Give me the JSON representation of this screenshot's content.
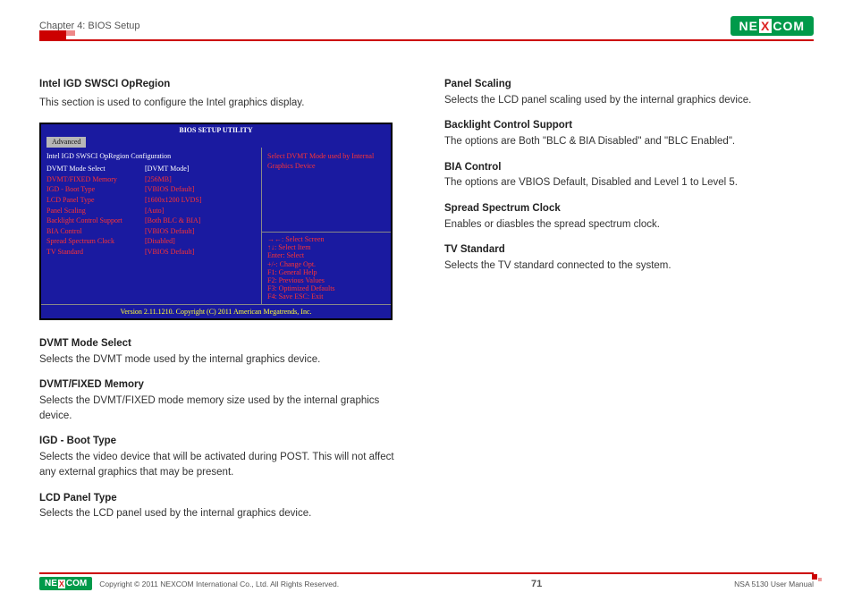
{
  "header": {
    "chapter": "Chapter 4: BIOS Setup",
    "brand": "NE",
    "brandX": "X",
    "brand2": "COM"
  },
  "left": {
    "title": "Intel IGD SWSCI OpRegion",
    "intro": "This section is used to configure the Intel graphics display.",
    "bios": {
      "title": "BIOS SETUP UTILITY",
      "tab": "Advanced",
      "section": "Intel IGD SWSCI OpRegion Configuration",
      "items": [
        {
          "label": "DVMT Mode Select",
          "value": "[DVMT Mode]"
        },
        {
          "label": "DVMT/FIXED Memory",
          "value": "[256MB]"
        },
        {
          "label": "IGD - Boot Type",
          "value": "[VBIOS Default]"
        },
        {
          "label": "LCD Panel Type",
          "value": "[1600x1200 LVDS]"
        },
        {
          "label": "Panel Scaling",
          "value": "[Auto]"
        },
        {
          "label": "Backlight Control Support",
          "value": "[Both BLC & BIA]"
        },
        {
          "label": "BIA Control",
          "value": "[VBIOS Default]"
        },
        {
          "label": "Spread Spectrum Clock",
          "value": "[Disabled]"
        },
        {
          "label": "TV Standard",
          "value": "[VBIOS Default]"
        }
      ],
      "help": "Select DVMT Mode used by Internal Graphics Device",
      "keys": [
        "→←:   Select Screen",
        "↑↓:    Select Item",
        "Enter: Select",
        "+/-:   Change Opt.",
        "F1:    General Help",
        "F2:    Previous Values",
        "F3:    Optimized Defaults",
        "F4:    Save   ESC: Exit"
      ],
      "version": "Version 2.11.1210. Copyright (C) 2011 American Megatrends, Inc."
    },
    "sections": [
      {
        "h": "DVMT Mode Select",
        "p": "Selects the DVMT mode used by the internal graphics device."
      },
      {
        "h": "DVMT/FIXED Memory",
        "p": "Selects the DVMT/FIXED mode memory size used by the internal graphics device."
      },
      {
        "h": "IGD - Boot Type",
        "p": "Selects the video device that will be activated during POST. This will not affect any external graphics that may be present."
      },
      {
        "h": "LCD Panel Type",
        "p": "Selects the LCD panel used by the internal graphics device."
      }
    ]
  },
  "right": {
    "sections": [
      {
        "h": "Panel Scaling",
        "p": "Selects the LCD panel scaling used by the internal graphics device."
      },
      {
        "h": "Backlight Control Support",
        "p": "The options are Both \"BLC & BIA Disabled\" and \"BLC Enabled\"."
      },
      {
        "h": "BIA Control",
        "p": "The options are VBIOS Default, Disabled and Level 1 to Level 5."
      },
      {
        "h": "Spread Spectrum Clock",
        "p": "Enables or diasbles the spread spectrum clock."
      },
      {
        "h": "TV Standard",
        "p": "Selects the TV standard connected to the system."
      }
    ]
  },
  "footer": {
    "copyright": "Copyright © 2011 NEXCOM International Co., Ltd. All Rights Reserved.",
    "page": "71",
    "manual": "NSA 5130 User Manual"
  }
}
